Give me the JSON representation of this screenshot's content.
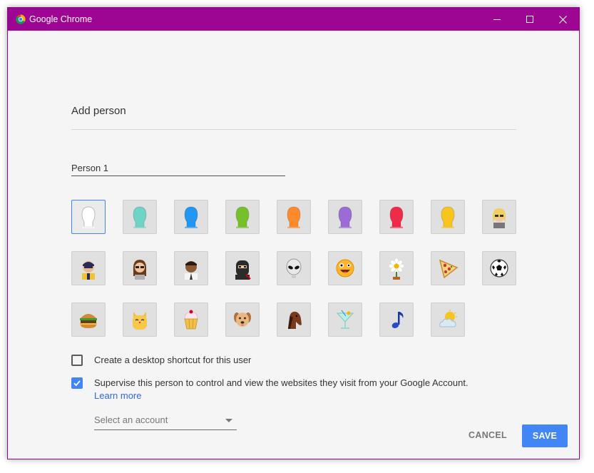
{
  "window": {
    "title": "Google Chrome",
    "titlebar_color": "#9c0693"
  },
  "dialog": {
    "title": "Add person",
    "name_value": "Person 1"
  },
  "avatars": [
    {
      "name": "generic-white-avatar-icon",
      "color": "#ffffff",
      "selected": true
    },
    {
      "name": "generic-aqua-avatar-icon",
      "color": "#6fd3c8"
    },
    {
      "name": "generic-blue-avatar-icon",
      "color": "#2196f3"
    },
    {
      "name": "generic-green-avatar-icon",
      "color": "#76c02b"
    },
    {
      "name": "generic-orange-avatar-icon",
      "color": "#ff8a2a"
    },
    {
      "name": "generic-purple-avatar-icon",
      "color": "#9b6bd6"
    },
    {
      "name": "generic-red-avatar-icon",
      "color": "#ee2b4a"
    },
    {
      "name": "generic-yellow-avatar-icon",
      "color": "#f7c51e"
    },
    {
      "name": "businesswoman-avatar-icon"
    },
    {
      "name": "ninja-man-avatar-icon"
    },
    {
      "name": "woman-avatar-icon"
    },
    {
      "name": "businessman-avatar-icon"
    },
    {
      "name": "ninja-avatar-icon"
    },
    {
      "name": "alien-avatar-icon"
    },
    {
      "name": "smiley-avatar-icon"
    },
    {
      "name": "flower-avatar-icon"
    },
    {
      "name": "pizza-avatar-icon"
    },
    {
      "name": "soccer-ball-avatar-icon"
    },
    {
      "name": "burger-avatar-icon"
    },
    {
      "name": "cat-avatar-icon"
    },
    {
      "name": "cupcake-avatar-icon"
    },
    {
      "name": "dog-avatar-icon"
    },
    {
      "name": "horse-avatar-icon"
    },
    {
      "name": "cocktail-avatar-icon"
    },
    {
      "name": "music-note-avatar-icon"
    },
    {
      "name": "sun-cloud-avatar-icon"
    }
  ],
  "options": {
    "desktop_shortcut_label": "Create a desktop shortcut for this user",
    "desktop_shortcut_checked": false,
    "supervise_label": "Supervise this person to control and view the websites they visit from your Google Account.",
    "supervise_checked": true,
    "learn_more": "Learn more",
    "select_account_placeholder": "Select an account"
  },
  "buttons": {
    "cancel": "CANCEL",
    "save": "SAVE"
  },
  "colors": {
    "accent": "#4285f4",
    "link": "#3367d6"
  }
}
